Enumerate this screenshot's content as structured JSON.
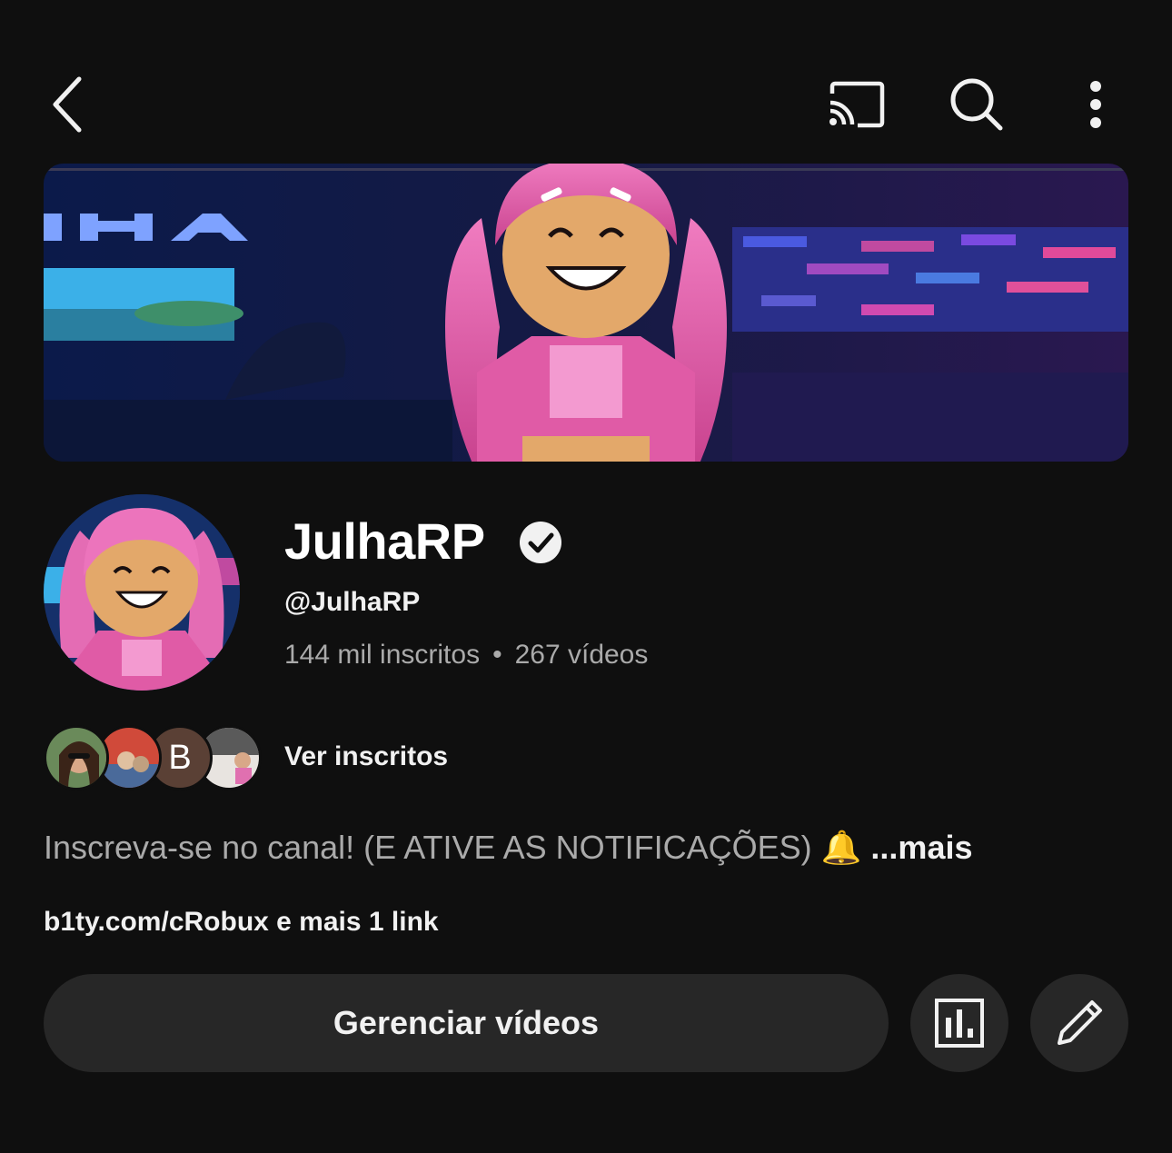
{
  "topbar": {
    "icons": [
      "back-arrow-icon",
      "cast-icon",
      "search-icon",
      "more-vertical-icon"
    ]
  },
  "channel": {
    "name": "JulhaRP",
    "verified": true,
    "handle": "@JulhaRP",
    "subscribers": "144 mil inscritos",
    "separator": "•",
    "videos": "267 vídeos"
  },
  "subscribers_preview": {
    "letter_avatar": "B",
    "label": "Ver inscritos"
  },
  "description": {
    "text": "Inscreva-se no canal! (E ATIVE AS NOTIFICAÇÕES) 🔔",
    "more": "...mais"
  },
  "links": {
    "text": "b1ty.com/cRobux e mais 1 link"
  },
  "actions": {
    "manage_label": "Gerenciar vídeos",
    "analytics_icon": "bar-chart-icon",
    "edit_icon": "pencil-icon"
  },
  "colors": {
    "background": "#0f0f0f",
    "button": "#272727",
    "secondary_text": "#aaaaaa",
    "primary_text": "#f1f1f1"
  }
}
